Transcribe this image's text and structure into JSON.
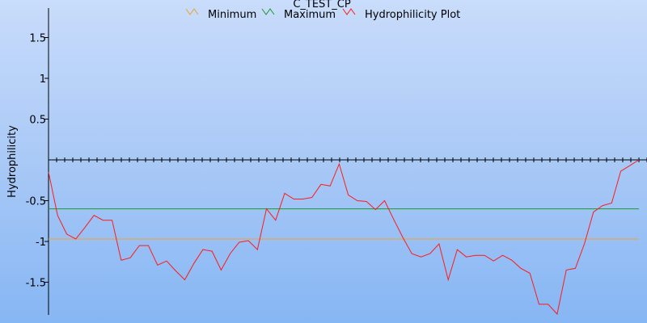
{
  "chart_data": {
    "type": "line",
    "title": "C_TEST_CP",
    "xlabel": "",
    "ylabel": "Hydrophilicity",
    "ylim": [
      -1.9,
      1.9
    ],
    "yticks": [
      1.5,
      1,
      0.5,
      -0.5,
      -1,
      -1.5
    ],
    "ytick_labels": [
      "1.5",
      "1",
      "0.5",
      "-0.5",
      "-1",
      "-1.5"
    ],
    "xlim": [
      0,
      65
    ],
    "grid": false,
    "legend_position": "top",
    "series": [
      {
        "name": "Minimum",
        "color": "#f0a030",
        "x": [
          0,
          65
        ],
        "y": [
          -0.97,
          -0.97
        ]
      },
      {
        "name": "Maximum",
        "color": "#1a9a2a",
        "x": [
          0,
          65
        ],
        "y": [
          -0.6,
          -0.6
        ]
      },
      {
        "name": "Hydrophilicity Plot",
        "color": "#ff1a1a",
        "x": [
          0,
          1,
          2,
          3,
          4,
          5,
          6,
          7,
          8,
          9,
          10,
          11,
          12,
          13,
          14,
          15,
          16,
          17,
          18,
          19,
          20,
          21,
          22,
          23,
          24,
          25,
          26,
          27,
          28,
          29,
          30,
          31,
          32,
          33,
          34,
          35,
          36,
          37,
          38,
          39,
          40,
          41,
          42,
          43,
          44,
          45,
          46,
          47,
          48,
          49,
          50,
          51,
          52,
          53,
          54,
          55,
          56,
          57,
          58,
          59,
          60,
          61,
          62,
          63,
          64,
          65
        ],
        "y": [
          -0.15,
          -0.68,
          -0.91,
          -0.97,
          -0.83,
          -0.68,
          -0.74,
          -0.74,
          -1.23,
          -1.2,
          -1.05,
          -1.05,
          -1.29,
          -1.24,
          -1.36,
          -1.47,
          -1.27,
          -1.1,
          -1.12,
          -1.35,
          -1.15,
          -1.01,
          -0.99,
          -1.1,
          -0.6,
          -0.74,
          -0.41,
          -0.48,
          -0.48,
          -0.46,
          -0.3,
          -0.32,
          -0.05,
          -0.43,
          -0.5,
          -0.51,
          -0.61,
          -0.5,
          -0.73,
          -0.95,
          -1.15,
          -1.19,
          -1.15,
          -1.03,
          -1.47,
          -1.1,
          -1.19,
          -1.17,
          -1.17,
          -1.24,
          -1.17,
          -1.23,
          -1.33,
          -1.39,
          -1.77,
          -1.77,
          -1.89,
          -1.35,
          -1.33,
          -1.03,
          -0.64,
          -0.56,
          -0.53,
          -0.14,
          -0.07,
          0.0
        ]
      }
    ]
  }
}
